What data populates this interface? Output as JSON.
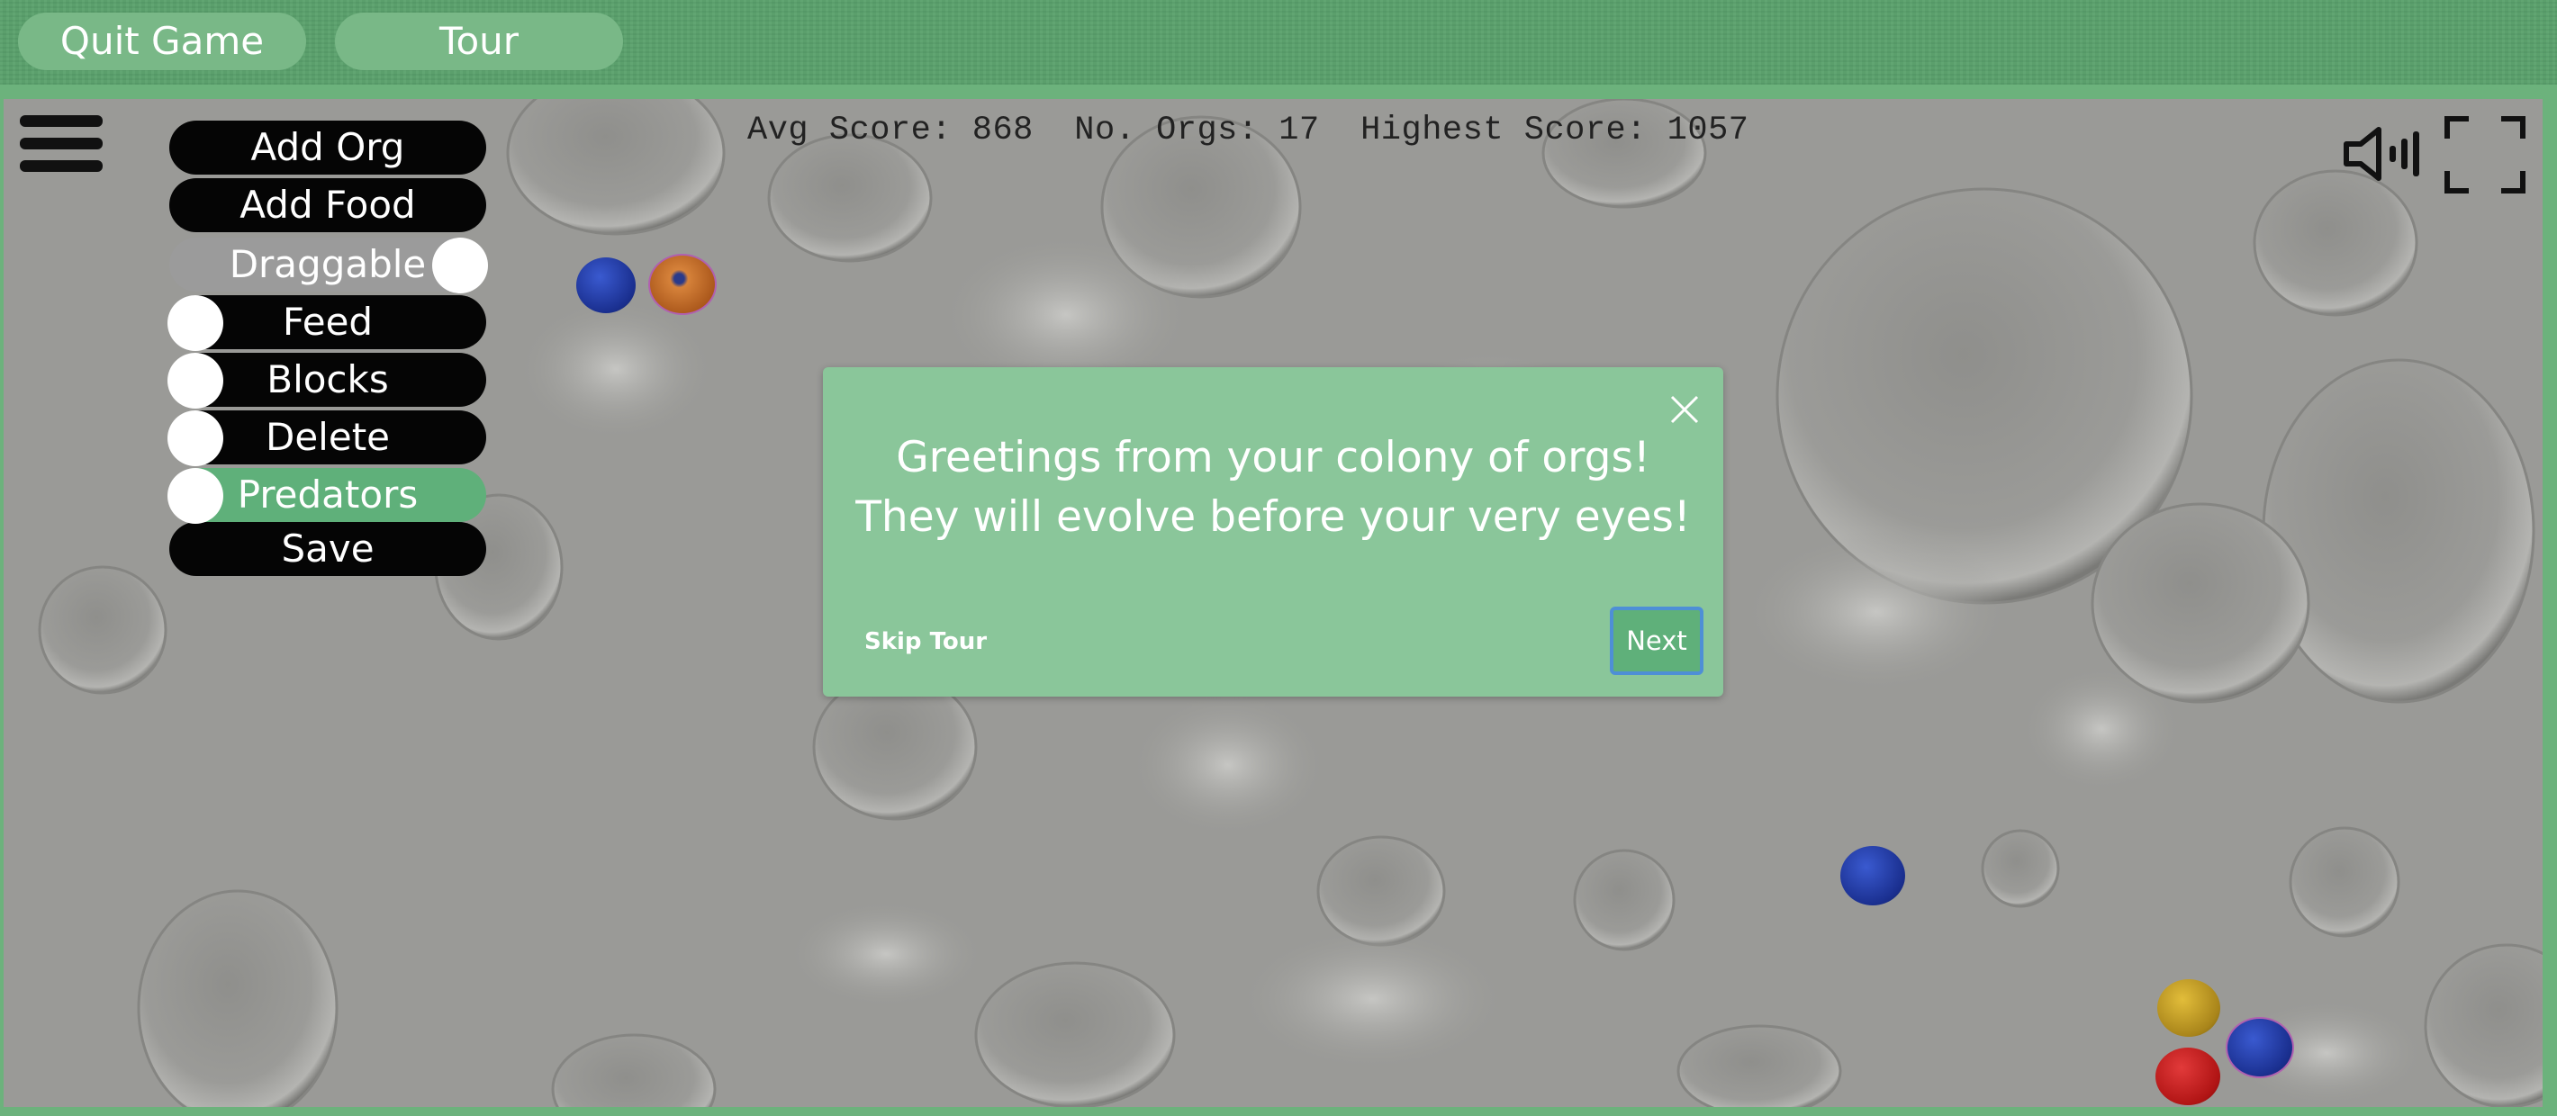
{
  "topbar": {
    "quit_label": "Quit Game",
    "tour_label": "Tour"
  },
  "menu": {
    "items": [
      {
        "label": "Add Org"
      },
      {
        "label": "Add Food"
      },
      {
        "label": "Draggable",
        "toggle": "on"
      },
      {
        "label": "Feed",
        "toggle": "off"
      },
      {
        "label": "Blocks",
        "toggle": "off"
      },
      {
        "label": "Delete",
        "toggle": "off"
      },
      {
        "label": "Predators",
        "toggle": "off"
      },
      {
        "label": "Save"
      }
    ]
  },
  "stats": {
    "text": "Avg Score: 868  No. Orgs: 17  Highest Score: 1057"
  },
  "tour": {
    "line1": "Greetings from your colony of orgs!",
    "line2": "They will evolve before your very eyes!",
    "skip_label": "Skip Tour",
    "next_label": "Next"
  },
  "icons": {
    "menu": "hamburger-icon",
    "sound": "speaker-icon",
    "fullscreen": "fullscreen-icon",
    "close": "close-icon"
  },
  "colors": {
    "accent": "#5fb07a",
    "dialog": "#8ac69a",
    "terrain": "#9a9a97",
    "org_blue": "#1e3aa8",
    "org_orange": "#c26a1e",
    "org_yellow": "#c8a21e",
    "org_red": "#c01818"
  }
}
